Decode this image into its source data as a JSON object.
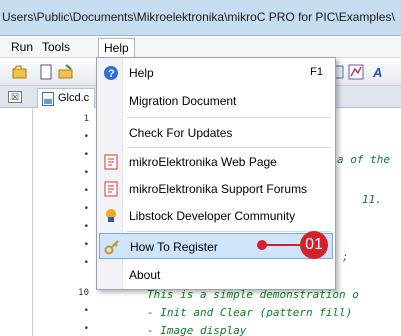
{
  "titlebar": {
    "path": "Users\\Public\\Documents\\Mikroelektronika\\mikroC PRO for PIC\\Examples\\"
  },
  "menubar": {
    "items": [
      {
        "label": "Run"
      },
      {
        "label": "Tools"
      },
      {
        "label": "Help"
      }
    ]
  },
  "left_panel": {
    "close_glyph": "☒"
  },
  "editor": {
    "tab_label": "Glcd.c",
    "line_numbers": [
      "1",
      "•",
      "•",
      "•",
      "•",
      "•",
      "•",
      "•",
      "•",
      "10",
      "•",
      "•"
    ],
    "code_lines": [
      {
        "text": "a of the"
      },
      {
        "text": "11."
      },
      {
        "text": ";"
      },
      {
        "text": "This is a simple demonstration o"
      },
      {
        "text": "- Init and Clear (pattern fill)"
      },
      {
        "text": "- Image display"
      }
    ]
  },
  "help_menu": {
    "items": [
      {
        "label": "Help",
        "shortcut": "F1",
        "icon": "help-icon"
      },
      {
        "label": "Migration Document"
      },
      {
        "label": "Check For Updates"
      },
      {
        "label": "mikroElektronika Web Page",
        "icon": "web-page-icon"
      },
      {
        "label": "mikroElektronika Support Forums",
        "icon": "forums-icon"
      },
      {
        "label": "Libstock Developer Community",
        "icon": "libstock-icon"
      },
      {
        "label": "How To Register",
        "icon": "key-icon",
        "highlighted": true
      },
      {
        "label": "About"
      }
    ]
  },
  "callout": {
    "number": "01",
    "color": "#d42028"
  }
}
